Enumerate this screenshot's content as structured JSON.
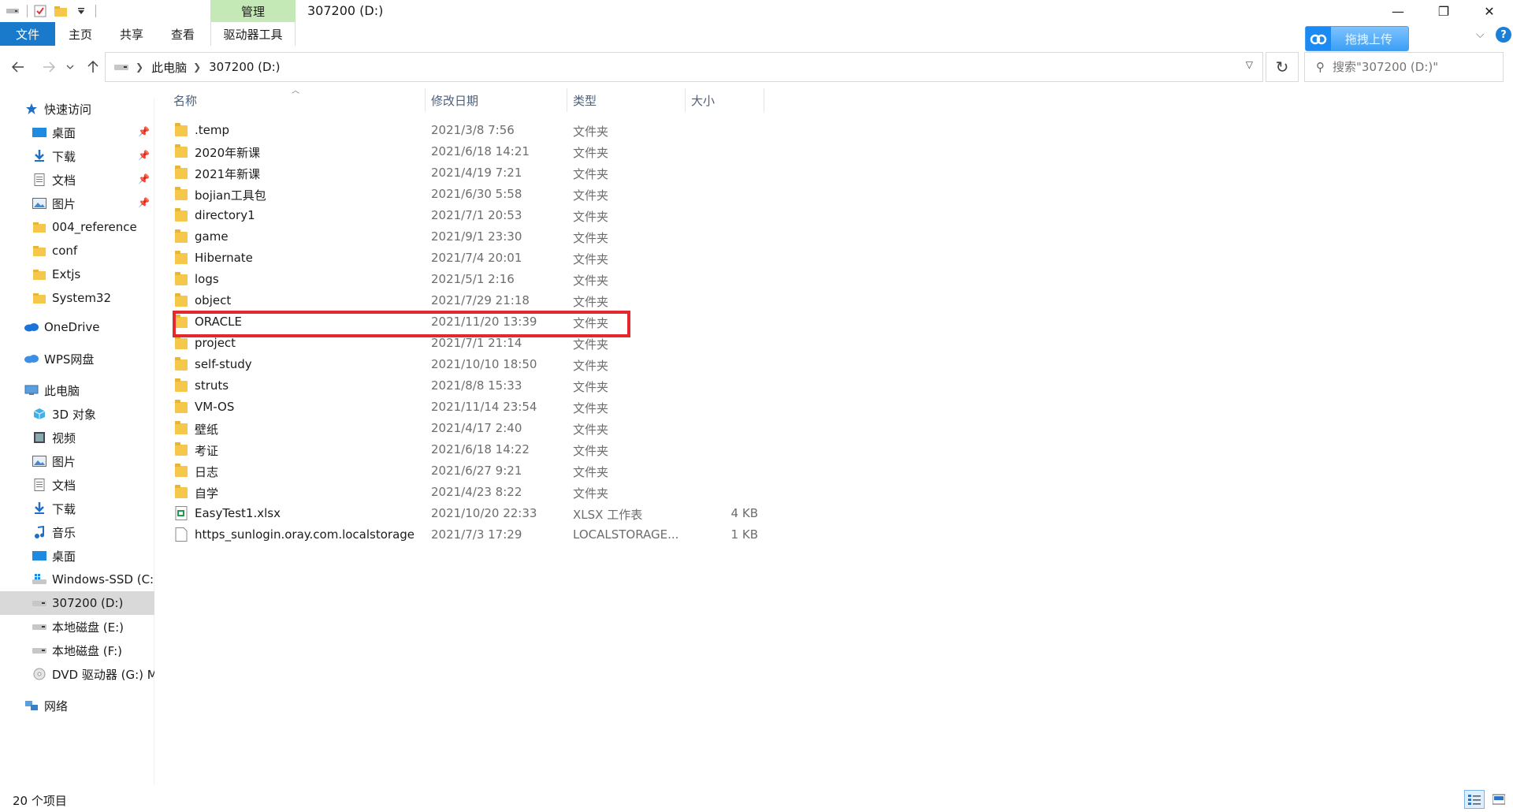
{
  "window": {
    "title": "307200 (D:)",
    "manage_tab": "管理",
    "controls": {
      "minimize": "—",
      "maximize": "❐",
      "close": "✕"
    }
  },
  "ribbon": {
    "tabs": [
      {
        "label": "文件"
      },
      {
        "label": "主页"
      },
      {
        "label": "共享"
      },
      {
        "label": "查看"
      },
      {
        "label": "驱动器工具"
      }
    ],
    "upload_label": "拖拽上传",
    "help": "?",
    "collapse_chevron": "⌵"
  },
  "address": {
    "crumbs": [
      "此电脑",
      "307200 (D:)"
    ],
    "search_placeholder": "搜索\"307200 (D:)\""
  },
  "sidebar": {
    "items": [
      {
        "label": "快速访问",
        "icon": "star-icon",
        "level": 0
      },
      {
        "label": "桌面",
        "icon": "desktop-icon",
        "level": 1,
        "pinned": true
      },
      {
        "label": "下载",
        "icon": "download-icon",
        "level": 1,
        "pinned": true
      },
      {
        "label": "文档",
        "icon": "document-icon",
        "level": 1,
        "pinned": true
      },
      {
        "label": "图片",
        "icon": "picture-icon",
        "level": 1,
        "pinned": true
      },
      {
        "label": "004_reference",
        "icon": "folder-icon",
        "level": 1
      },
      {
        "label": "conf",
        "icon": "folder-icon",
        "level": 1
      },
      {
        "label": "Extjs",
        "icon": "folder-icon",
        "level": 1
      },
      {
        "label": "System32",
        "icon": "folder-icon",
        "level": 1
      },
      {
        "label": "OneDrive",
        "icon": "cloud-icon",
        "level": 0
      },
      {
        "label": "WPS网盘",
        "icon": "wps-cloud-icon",
        "level": 0
      },
      {
        "label": "此电脑",
        "icon": "computer-icon",
        "level": 0
      },
      {
        "label": "3D 对象",
        "icon": "cube-icon",
        "level": 1
      },
      {
        "label": "视频",
        "icon": "video-icon",
        "level": 1
      },
      {
        "label": "图片",
        "icon": "picture-icon",
        "level": 1
      },
      {
        "label": "文档",
        "icon": "document-icon",
        "level": 1
      },
      {
        "label": "下载",
        "icon": "download-icon",
        "level": 1
      },
      {
        "label": "音乐",
        "icon": "music-icon",
        "level": 1
      },
      {
        "label": "桌面",
        "icon": "desktop-icon",
        "level": 1
      },
      {
        "label": "Windows-SSD (C:)",
        "icon": "windows-drive-icon",
        "level": 1
      },
      {
        "label": "307200 (D:)",
        "icon": "drive-icon",
        "level": 1,
        "selected": true
      },
      {
        "label": "本地磁盘 (E:)",
        "icon": "drive-icon",
        "level": 1
      },
      {
        "label": "本地磁盘 (F:)",
        "icon": "drive-icon",
        "level": 1
      },
      {
        "label": "DVD 驱动器 (G:) M",
        "icon": "dvd-icon",
        "level": 1
      },
      {
        "label": "网络",
        "icon": "network-icon",
        "level": 0
      }
    ]
  },
  "columns": {
    "name": "名称",
    "date": "修改日期",
    "type": "类型",
    "size": "大小"
  },
  "files": [
    {
      "name": ".temp",
      "date": "2021/3/8 7:56",
      "type": "文件夹",
      "size": "",
      "kind": "folder"
    },
    {
      "name": "2020年新课",
      "date": "2021/6/18 14:21",
      "type": "文件夹",
      "size": "",
      "kind": "folder"
    },
    {
      "name": "2021年新课",
      "date": "2021/4/19 7:21",
      "type": "文件夹",
      "size": "",
      "kind": "folder"
    },
    {
      "name": "bojian工具包",
      "date": "2021/6/30 5:58",
      "type": "文件夹",
      "size": "",
      "kind": "folder"
    },
    {
      "name": "directory1",
      "date": "2021/7/1 20:53",
      "type": "文件夹",
      "size": "",
      "kind": "folder"
    },
    {
      "name": "game",
      "date": "2021/9/1 23:30",
      "type": "文件夹",
      "size": "",
      "kind": "folder"
    },
    {
      "name": "Hibernate",
      "date": "2021/7/4 20:01",
      "type": "文件夹",
      "size": "",
      "kind": "folder"
    },
    {
      "name": "logs",
      "date": "2021/5/1 2:16",
      "type": "文件夹",
      "size": "",
      "kind": "folder"
    },
    {
      "name": "object",
      "date": "2021/7/29 21:18",
      "type": "文件夹",
      "size": "",
      "kind": "folder"
    },
    {
      "name": "ORACLE",
      "date": "2021/11/20 13:39",
      "type": "文件夹",
      "size": "",
      "kind": "folder"
    },
    {
      "name": "project",
      "date": "2021/7/1 21:14",
      "type": "文件夹",
      "size": "",
      "kind": "folder"
    },
    {
      "name": "self-study",
      "date": "2021/10/10 18:50",
      "type": "文件夹",
      "size": "",
      "kind": "folder"
    },
    {
      "name": "struts",
      "date": "2021/8/8 15:33",
      "type": "文件夹",
      "size": "",
      "kind": "folder"
    },
    {
      "name": "VM-OS",
      "date": "2021/11/14 23:54",
      "type": "文件夹",
      "size": "",
      "kind": "folder"
    },
    {
      "name": "壁纸",
      "date": "2021/4/17 2:40",
      "type": "文件夹",
      "size": "",
      "kind": "folder"
    },
    {
      "name": "考证",
      "date": "2021/6/18 14:22",
      "type": "文件夹",
      "size": "",
      "kind": "folder"
    },
    {
      "name": "日志",
      "date": "2021/6/27 9:21",
      "type": "文件夹",
      "size": "",
      "kind": "folder"
    },
    {
      "name": "自学",
      "date": "2021/4/23 8:22",
      "type": "文件夹",
      "size": "",
      "kind": "folder"
    },
    {
      "name": "EasyTest1.xlsx",
      "date": "2021/10/20 22:33",
      "type": "XLSX 工作表",
      "size": "4 KB",
      "kind": "xlsx"
    },
    {
      "name": "https_sunlogin.oray.com.localstorage",
      "date": "2021/7/3 17:29",
      "type": "LOCALSTORAGE...",
      "size": "1 KB",
      "kind": "file"
    }
  ],
  "highlighted_file": "ORACLE",
  "status": {
    "item_count": "20 个项目"
  },
  "colors": {
    "accent": "#1979ca",
    "manage_tab": "#c4e9b7",
    "highlight": "#e5282d",
    "folder": "#f5c74a"
  }
}
